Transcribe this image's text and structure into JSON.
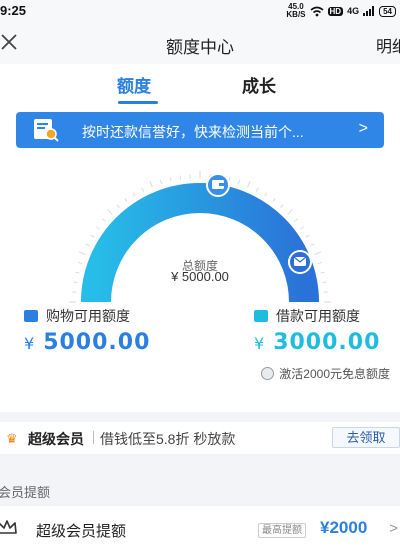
{
  "status_bar": {
    "time": "9:25",
    "speed_value": "45.0",
    "speed_unit": "KB/S",
    "hd": "HD",
    "network": "4G",
    "battery": "54"
  },
  "nav": {
    "title": "额度中心",
    "right_link": "明细"
  },
  "tabs": [
    {
      "label": "额度",
      "active": true
    },
    {
      "label": "成长",
      "active": false
    }
  ],
  "banner": {
    "text": "按时还款信誉好，快来检测当前个...",
    "chevron": ">"
  },
  "gauge": {
    "label": "总额度",
    "value": "¥ 5000.00",
    "fill_fraction": 1.0,
    "colors": {
      "start": "#27bde8",
      "end": "#2a72d8",
      "track": "#e6ebf1"
    }
  },
  "stats": {
    "shopping": {
      "label": "购物可用额度",
      "currency": "¥",
      "amount": "5000.00"
    },
    "loan": {
      "label": "借款可用额度",
      "currency": "¥",
      "amount": "3000.00"
    }
  },
  "free_interest": {
    "text": "激活2000元免息额度"
  },
  "member": {
    "name": "超级会员",
    "desc": "借钱低至5.8折 秒放款",
    "button": "去领取"
  },
  "section": {
    "header": "会员提额",
    "row": {
      "name": "超级会员提额",
      "tag": "最高提额",
      "value": "¥2000",
      "chevron": ">"
    }
  },
  "colors": {
    "accent": "#2a7fe0",
    "cyan": "#1ebde0",
    "banner": "#2f86e6"
  }
}
